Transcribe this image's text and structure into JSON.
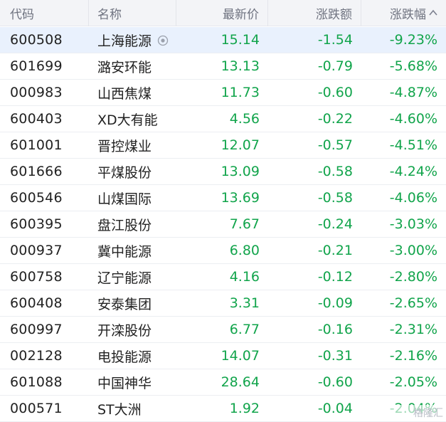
{
  "header": {
    "code": "代码",
    "name": "名称",
    "price": "最新价",
    "change": "涨跌额",
    "pct": "涨跌幅",
    "sort_icon": "caret-up-icon"
  },
  "rows": [
    {
      "code": "600508",
      "name": "上海能源",
      "price": "15.14",
      "change": "-1.54",
      "pct": "-9.23%",
      "selected": true
    },
    {
      "code": "601699",
      "name": "潞安环能",
      "price": "13.13",
      "change": "-0.79",
      "pct": "-5.68%"
    },
    {
      "code": "000983",
      "name": "山西焦煤",
      "price": "11.73",
      "change": "-0.60",
      "pct": "-4.87%"
    },
    {
      "code": "600403",
      "name": "XD大有能",
      "price": "4.56",
      "change": "-0.22",
      "pct": "-4.60%"
    },
    {
      "code": "601001",
      "name": "晋控煤业",
      "price": "12.07",
      "change": "-0.57",
      "pct": "-4.51%"
    },
    {
      "code": "601666",
      "name": "平煤股份",
      "price": "13.09",
      "change": "-0.58",
      "pct": "-4.24%"
    },
    {
      "code": "600546",
      "name": "山煤国际",
      "price": "13.69",
      "change": "-0.58",
      "pct": "-4.06%"
    },
    {
      "code": "600395",
      "name": "盘江股份",
      "price": "7.67",
      "change": "-0.24",
      "pct": "-3.03%"
    },
    {
      "code": "000937",
      "name": "冀中能源",
      "price": "6.80",
      "change": "-0.21",
      "pct": "-3.00%"
    },
    {
      "code": "600758",
      "name": "辽宁能源",
      "price": "4.16",
      "change": "-0.12",
      "pct": "-2.80%"
    },
    {
      "code": "600408",
      "name": "安泰集团",
      "price": "3.31",
      "change": "-0.09",
      "pct": "-2.65%"
    },
    {
      "code": "600997",
      "name": "开滦股份",
      "price": "6.77",
      "change": "-0.16",
      "pct": "-2.31%"
    },
    {
      "code": "002128",
      "name": "电投能源",
      "price": "14.07",
      "change": "-0.31",
      "pct": "-2.16%"
    },
    {
      "code": "601088",
      "name": "中国神华",
      "price": "28.64",
      "change": "-0.60",
      "pct": "-2.05%"
    },
    {
      "code": "000571",
      "name": "ST大洲",
      "price": "1.92",
      "change": "-0.04",
      "pct": "-2.04%"
    }
  ],
  "colors": {
    "down": "#11a44b",
    "header_bg": "#f3f4f7",
    "selected_bg": "#e9f1fd"
  },
  "watermark": "格隆汇"
}
